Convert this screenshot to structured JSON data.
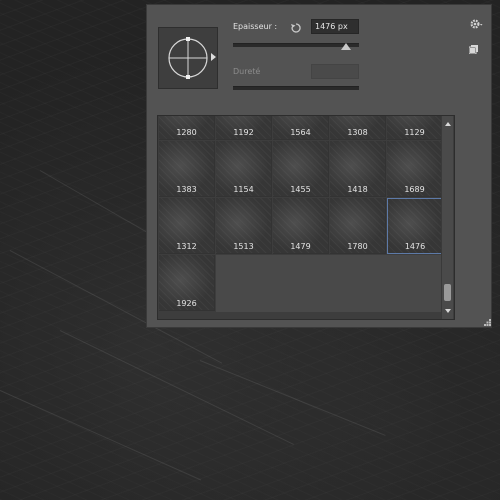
{
  "brush_panel": {
    "size_label": "Epaisseur :",
    "size_value": "1476 px",
    "hardness_label": "Dureté",
    "size_slider_fraction": 0.9,
    "icons": {
      "preview": "brush-tip-crosshair-icon",
      "reset": "reset-size-icon",
      "settings": "gear-icon",
      "panel_menu": "new-preset-icon",
      "resize": "resize-grip-icon"
    },
    "brushes": [
      {
        "label": "1280",
        "selected": false
      },
      {
        "label": "1192",
        "selected": false
      },
      {
        "label": "1564",
        "selected": false
      },
      {
        "label": "1308",
        "selected": false
      },
      {
        "label": "1129",
        "selected": false
      },
      {
        "label": "1383",
        "selected": false
      },
      {
        "label": "1154",
        "selected": false
      },
      {
        "label": "1455",
        "selected": false
      },
      {
        "label": "1418",
        "selected": false
      },
      {
        "label": "1689",
        "selected": false
      },
      {
        "label": "1312",
        "selected": false
      },
      {
        "label": "1513",
        "selected": false
      },
      {
        "label": "1479",
        "selected": false
      },
      {
        "label": "1780",
        "selected": false
      },
      {
        "label": "1476",
        "selected": true
      },
      {
        "label": "1926",
        "selected": false
      }
    ],
    "selection_color": "#5d7aa8"
  }
}
